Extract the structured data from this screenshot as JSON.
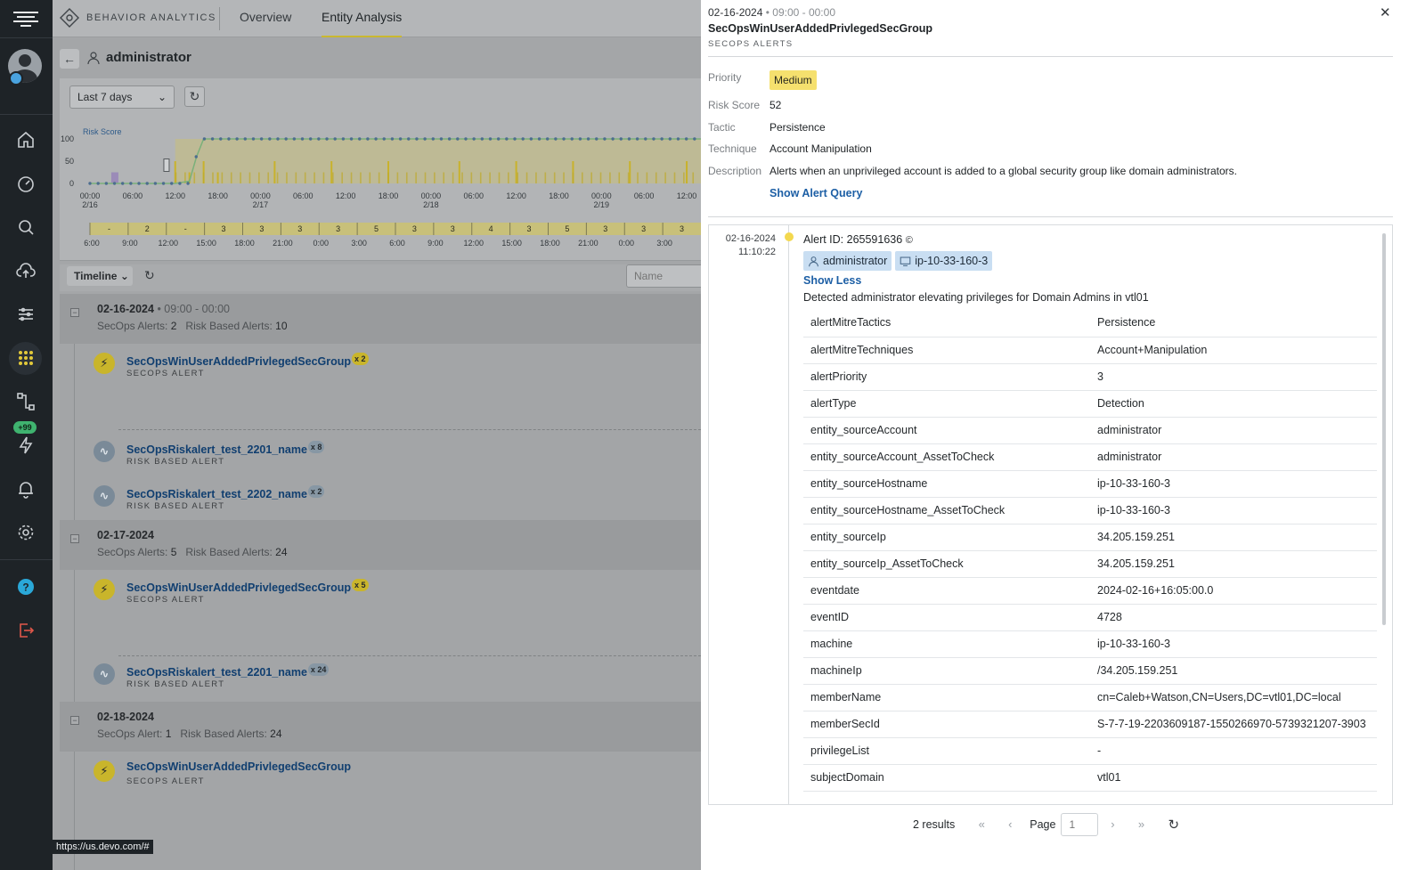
{
  "app": {
    "brand": "BEHAVIOR ANALYTICS",
    "tabs": [
      {
        "label": "Overview"
      },
      {
        "label": "Entity Analysis",
        "active": true
      }
    ],
    "sidebar_badge": "+99",
    "status_url": "https://us.devo.com/#"
  },
  "entity": {
    "name": "administrator"
  },
  "controls": {
    "range": "Last 7 days",
    "timeline_label": "Timeline",
    "name_placeholder": "Name"
  },
  "chart_data": {
    "type": "bar",
    "ylabel": "Risk Score",
    "ylim": [
      0,
      100
    ],
    "yticks": [
      "100",
      "50",
      "0"
    ],
    "xticks": [
      {
        "l1": "00:00",
        "l2": "2/16"
      },
      {
        "l1": "06:00",
        "l2": ""
      },
      {
        "l1": "12:00",
        "l2": ""
      },
      {
        "l1": "18:00",
        "l2": ""
      },
      {
        "l1": "00:00",
        "l2": "2/17"
      },
      {
        "l1": "06:00",
        "l2": ""
      },
      {
        "l1": "12:00",
        "l2": ""
      },
      {
        "l1": "18:00",
        "l2": ""
      },
      {
        "l1": "00:00",
        "l2": "2/18"
      },
      {
        "l1": "06:00",
        "l2": ""
      },
      {
        "l1": "12:00",
        "l2": ""
      },
      {
        "l1": "18:00",
        "l2": ""
      },
      {
        "l1": "00:00",
        "l2": "2/19"
      },
      {
        "l1": "06:00",
        "l2": ""
      },
      {
        "l1": "12:00",
        "l2": ""
      }
    ],
    "series": [
      {
        "name": "Risk Score",
        "kind": "line",
        "points": [
          [
            0,
            0
          ],
          [
            2,
            0
          ],
          [
            4,
            0
          ],
          [
            6,
            0
          ],
          [
            8,
            0
          ],
          [
            10,
            0
          ],
          [
            12,
            0
          ],
          [
            14,
            5
          ],
          [
            15,
            60
          ],
          [
            16,
            100
          ],
          [
            86,
            100
          ]
        ]
      }
    ],
    "bars": [
      {
        "x": 12,
        "v": 50
      },
      {
        "x": 14,
        "v": 25
      },
      {
        "x": 16,
        "v": 50
      },
      {
        "x": 18,
        "v": 25
      },
      {
        "x": 26,
        "v": 50
      },
      {
        "x": 34,
        "v": 50
      },
      {
        "x": 42,
        "v": 50
      },
      {
        "x": 52,
        "v": 50
      },
      {
        "x": 60,
        "v": 50
      },
      {
        "x": 68,
        "v": 50
      },
      {
        "x": 76,
        "v": 50
      },
      {
        "x": 84,
        "v": 50
      }
    ],
    "x_range": [
      0,
      86
    ],
    "count_strip": [
      "-",
      "2",
      "-",
      "3",
      "3",
      "3",
      "3",
      "5",
      "3",
      "3",
      "4",
      "3",
      "5",
      "3",
      "3",
      "3"
    ],
    "count_ticks": [
      "6:00",
      "9:00",
      "12:00",
      "15:00",
      "18:00",
      "21:00",
      "0:00",
      "3:00",
      "6:00",
      "9:00",
      "12:00",
      "15:00",
      "18:00",
      "21:00",
      "0:00",
      "3:00"
    ]
  },
  "timeline": {
    "days": [
      {
        "date": "02-16-2024",
        "time": "09:00 - 00:00",
        "secops_label": "SecOps Alerts:",
        "secops": "2",
        "risk_label": "Risk Based Alerts:",
        "risk": "10",
        "alerts": [
          {
            "name": "SecOpsWinUserAddedPrivlegedSecGroup",
            "count": "x 2",
            "type": "SECOPS ALERT",
            "kind": "secops"
          },
          {
            "name": "SecOpsRiskalert_test_2201_name",
            "count": "x 8",
            "type": "RISK BASED ALERT",
            "kind": "risk"
          },
          {
            "name": "SecOpsRiskalert_test_2202_name",
            "count": "x 2",
            "type": "RISK BASED ALERT",
            "kind": "risk"
          }
        ]
      },
      {
        "date": "02-17-2024",
        "time": "",
        "secops_label": "SecOps Alerts:",
        "secops": "5",
        "risk_label": "Risk Based Alerts:",
        "risk": "24",
        "alerts": [
          {
            "name": "SecOpsWinUserAddedPrivlegedSecGroup",
            "count": "x 5",
            "type": "SECOPS ALERT",
            "kind": "secops"
          },
          {
            "name": "SecOpsRiskalert_test_2201_name",
            "count": "x 24",
            "type": "RISK BASED ALERT",
            "kind": "risk"
          }
        ]
      },
      {
        "date": "02-18-2024",
        "time": "",
        "secops_label": "SecOps Alert:",
        "secops": "1",
        "risk_label": "Risk Based Alerts:",
        "risk": "24",
        "alerts": [
          {
            "name": "SecOpsWinUserAddedPrivlegedSecGroup",
            "count": "",
            "type": "SECOPS ALERT",
            "kind": "secops"
          }
        ]
      }
    ]
  },
  "panel": {
    "date": "02-16-2024",
    "time": "• 09:00 - 00:00",
    "title": "SecOpsWinUserAddedPrivlegedSecGroup",
    "subtitle": "SECOPS ALERTS",
    "fields": {
      "priority_label": "Priority",
      "priority": "Medium",
      "risk_label": "Risk Score",
      "risk": "52",
      "tactic_label": "Tactic",
      "tactic": "Persistence",
      "technique_label": "Technique",
      "technique": "Account Manipulation",
      "description_label": "Description",
      "description": "Alerts when an unprivileged account is added to a global security group like domain administrators."
    },
    "show_query": "Show Alert Query",
    "alert": {
      "date": "02-16-2024",
      "time": "11:10:22",
      "id_label": "Alert ID: 265591636",
      "chip_user": "administrator",
      "chip_host": "ip-10-33-160-3",
      "show_less": "Show Less",
      "detected": "Detected administrator elevating privileges for Domain Admins in vtl01",
      "rows": [
        {
          "k": "alertMitreTactics",
          "v": "Persistence"
        },
        {
          "k": "alertMitreTechniques",
          "v": "Account+Manipulation"
        },
        {
          "k": "alertPriority",
          "v": "3"
        },
        {
          "k": "alertType",
          "v": "Detection"
        },
        {
          "k": "entity_sourceAccount",
          "v": "administrator"
        },
        {
          "k": "entity_sourceAccount_AssetToCheck",
          "v": "administrator"
        },
        {
          "k": "entity_sourceHostname",
          "v": "ip-10-33-160-3"
        },
        {
          "k": "entity_sourceHostname_AssetToCheck",
          "v": "ip-10-33-160-3"
        },
        {
          "k": "entity_sourceIp",
          "v": "34.205.159.251"
        },
        {
          "k": "entity_sourceIp_AssetToCheck",
          "v": "34.205.159.251"
        },
        {
          "k": "eventdate",
          "v": "2024-02-16+16:05:00.0"
        },
        {
          "k": "eventID",
          "v": "4728"
        },
        {
          "k": "machine",
          "v": "ip-10-33-160-3"
        },
        {
          "k": "machineIp",
          "v": "/34.205.159.251"
        },
        {
          "k": "memberName",
          "v": "cn=Caleb+Watson,CN=Users,DC=vtl01,DC=local"
        },
        {
          "k": "memberSecId",
          "v": "S-7-7-19-2203609187-1550266970-5739321207-3903"
        },
        {
          "k": "privilegeList",
          "v": "-"
        },
        {
          "k": "subjectDomain",
          "v": "vtl01"
        }
      ]
    },
    "pager": {
      "results": "2 results",
      "page_label": "Page",
      "page": "1"
    }
  }
}
